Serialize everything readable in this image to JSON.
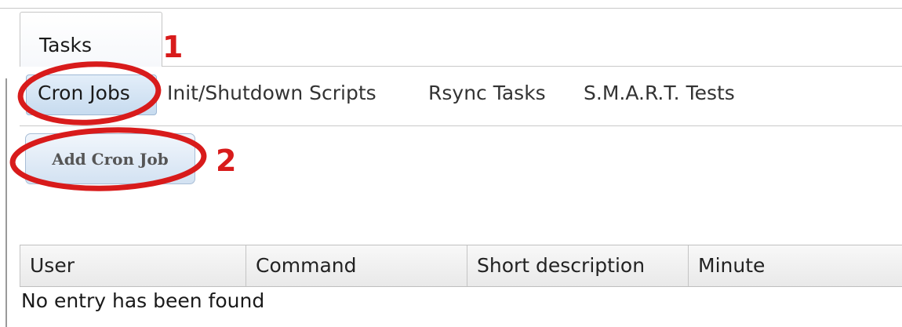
{
  "main_tab": {
    "label": "Tasks"
  },
  "sub_tabs": [
    {
      "label": "Cron Jobs",
      "active": true
    },
    {
      "label": "Init/Shutdown Scripts",
      "active": false
    },
    {
      "label": "Rsync Tasks",
      "active": false
    },
    {
      "label": "S.M.A.R.T. Tests",
      "active": false
    }
  ],
  "actions": {
    "add_label": "Add Cron Job"
  },
  "table": {
    "columns": [
      "User",
      "Command",
      "Short description",
      "Minute"
    ],
    "empty_message": "No entry has been found"
  },
  "annotations": {
    "step_1": "1",
    "step_2": "2",
    "color": "#d81b1b"
  }
}
